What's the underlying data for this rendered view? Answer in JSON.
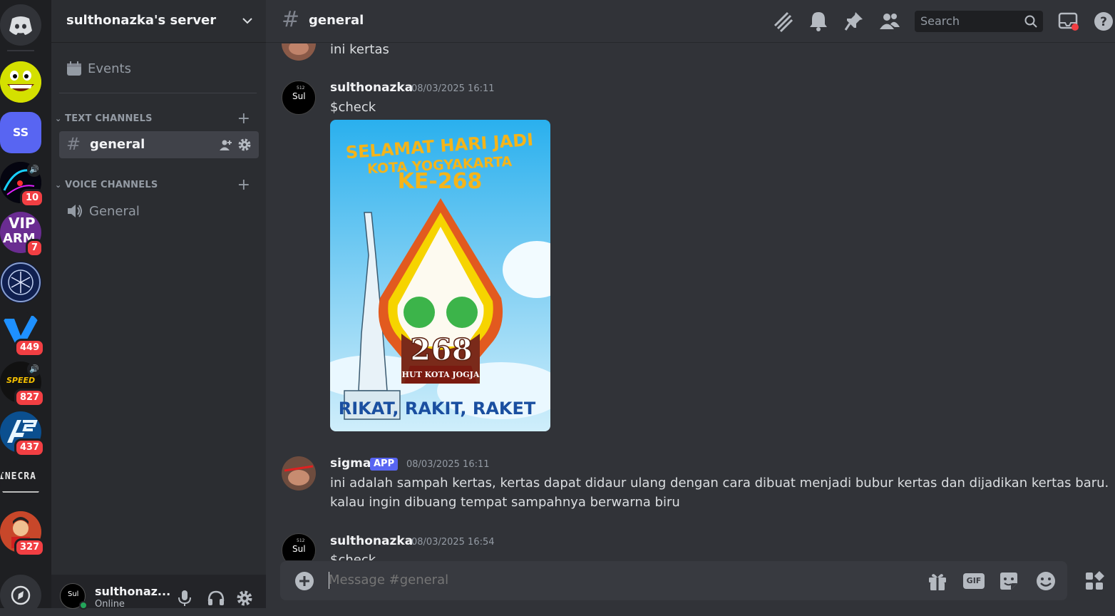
{
  "server": {
    "name": "sulthonazka's server",
    "events_label": "Events",
    "text_category": "TEXT CHANNELS",
    "voice_category": "VOICE CHANNELS",
    "text_channel": "general",
    "voice_channel": "General"
  },
  "rail": {
    "selected_server_initials": "SS",
    "badges": {
      "s4": "10",
      "s5": "7",
      "s7": "449",
      "s8": "827",
      "s9": "437",
      "s11": "327"
    },
    "vip_text_line1": "VIP",
    "vip_text_line2": "ARM",
    "speed_text": "SPEED",
    "minecraft_text": "INECRA"
  },
  "header": {
    "channel_name": "general",
    "search_placeholder": "Search"
  },
  "messages": [
    {
      "text": "ini kertas"
    },
    {
      "author": "sulthonazka",
      "timestamp": "08/03/2025 16:11",
      "text": "$check",
      "image": {
        "line1": "SELAMAT HARI JADI",
        "line2": "KOTA YOGYAKARTA",
        "line3": "KE-268",
        "number": "268",
        "sub": "HUT KOTA JOGJA",
        "footer": "RIKAT, RAKIT, RAKET"
      }
    },
    {
      "author": "sigma",
      "tag": "APP",
      "timestamp": "08/03/2025 16:11",
      "line1": "ini adalah sampah kertas, kertas dapat didaur ulang dengan cara dibuat menjadi bubur kertas dan dijadikan kertas baru.",
      "line2": "kalau ingin dibuang tempat sampahnya berwarna biru"
    },
    {
      "author": "sulthonazka",
      "timestamp": "08/03/2025 16:54",
      "text": "$check"
    }
  ],
  "avatar_text": {
    "line1": "Sul",
    "tiny": "512"
  },
  "composer": {
    "placeholder": "Message #general",
    "gif_label": "GIF"
  },
  "user": {
    "name": "sulthonaz...",
    "status": "Online"
  },
  "colors": {
    "blurple": "#5865f2",
    "red": "#f23f43",
    "green": "#23a55a"
  }
}
